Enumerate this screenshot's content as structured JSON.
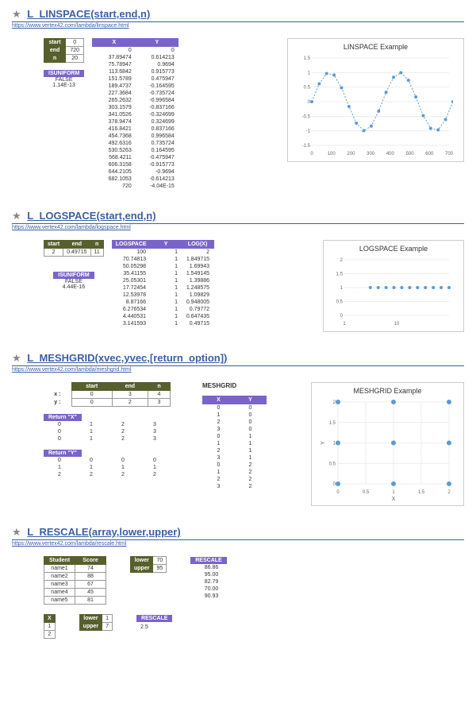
{
  "linspace": {
    "bullet": "★",
    "title": "L_LINSPACE(start,end,n)",
    "url": "https://www.vertex42.com/lambda/linspace.html",
    "params": {
      "labels": {
        "start": "start",
        "end": "end",
        "n": "n"
      },
      "values": {
        "start": "0",
        "end": "720",
        "n": "20"
      }
    },
    "isuniform": {
      "label": "ISUNIFORM",
      "val1": "FALSE",
      "val2": "1.14E-13"
    },
    "xy_header": {
      "x": "X",
      "y": "Y"
    },
    "xy": [
      [
        "0",
        "0"
      ],
      [
        "37.89474",
        "0.614213"
      ],
      [
        "75.78947",
        "0.9694"
      ],
      [
        "113.6842",
        "0.915773"
      ],
      [
        "151.5789",
        "0.475947"
      ],
      [
        "189.4737",
        "-0.164595"
      ],
      [
        "227.3684",
        "-0.735724"
      ],
      [
        "265.2632",
        "-0.996584"
      ],
      [
        "303.1579",
        "-0.837166"
      ],
      [
        "341.0526",
        "-0.324699"
      ],
      [
        "378.9474",
        "0.324699"
      ],
      [
        "416.8421",
        "0.837166"
      ],
      [
        "454.7368",
        "0.996584"
      ],
      [
        "492.6316",
        "0.735724"
      ],
      [
        "530.5263",
        "0.164595"
      ],
      [
        "568.4211",
        "-0.475947"
      ],
      [
        "606.3158",
        "-0.915773"
      ],
      [
        "644.2105",
        "-0.9694"
      ],
      [
        "682.1053",
        "-0.614213"
      ],
      [
        "720",
        "-4.04E-15"
      ]
    ],
    "chart": {
      "title": "LINSPACE Example",
      "x_ticks": [
        "0",
        "100",
        "200",
        "300",
        "400",
        "500",
        "600",
        "700"
      ],
      "y_ticks": [
        "-1.5",
        "-1",
        "-0.5",
        "0",
        "0.5",
        "1",
        "1.5"
      ]
    }
  },
  "logspace": {
    "bullet": "★",
    "title": "L_LOGSPACE(start,end,n)",
    "url": "https://www.vertex42.com/lambda/logspace.html",
    "params": {
      "labels": {
        "start": "start",
        "end": "end",
        "n": "n"
      },
      "values": {
        "start": "2",
        "end": "0.49715",
        "n": "11"
      }
    },
    "isuniform": {
      "label": "ISUNIFORM",
      "val1": "FALSE",
      "val2": "4.44E-16"
    },
    "header": {
      "a": "LOGSPACE",
      "b": "Y",
      "c": "LOG(X)"
    },
    "rows": [
      [
        "100",
        "1",
        "2"
      ],
      [
        "70.74813",
        "1",
        "1.849715"
      ],
      [
        "50.05298",
        "1",
        "1.69943"
      ],
      [
        "35.41155",
        "1",
        "1.549145"
      ],
      [
        "25.05301",
        "1",
        "1.39886"
      ],
      [
        "17.72454",
        "1",
        "1.248575"
      ],
      [
        "12.53978",
        "1",
        "1.09829"
      ],
      [
        "8.87166",
        "1",
        "0.948005"
      ],
      [
        "6.276534",
        "1",
        "0.79772"
      ],
      [
        "4.440531",
        "1",
        "0.647435"
      ],
      [
        "3.141593",
        "1",
        "0.49715"
      ]
    ],
    "chart": {
      "title": "LOGSPACE Example",
      "x_ticks": [
        "1",
        "10"
      ],
      "y_ticks": [
        "0",
        "0.5",
        "1",
        "1.5",
        "2"
      ]
    }
  },
  "meshgrid": {
    "bullet": "★",
    "title": "L_MESHGRID(xvec,yvec,[return_option])",
    "url": "https://www.vertex42.com/lambda/meshgrid.html",
    "header": {
      "start": "start",
      "end": "end",
      "n": "n"
    },
    "x_label": "x :",
    "y_label": "y :",
    "x_row": [
      "0",
      "3",
      "4"
    ],
    "y_row": [
      "0",
      "2",
      "3"
    ],
    "retX": {
      "label": "Return \"X\"",
      "rows": [
        [
          "0",
          "1",
          "2",
          "3"
        ],
        [
          "0",
          "1",
          "2",
          "3"
        ],
        [
          "0",
          "1",
          "2",
          "3"
        ]
      ]
    },
    "retY": {
      "label": "Return \"Y\"",
      "rows": [
        [
          "0",
          "0",
          "0",
          "0"
        ],
        [
          "1",
          "1",
          "1",
          "1"
        ],
        [
          "2",
          "2",
          "2",
          "2"
        ]
      ]
    },
    "mesh_header": "MESHGRID",
    "mesh_xy_header": {
      "x": "X",
      "y": "Y"
    },
    "mesh_rows": [
      [
        "0",
        "0"
      ],
      [
        "1",
        "0"
      ],
      [
        "2",
        "0"
      ],
      [
        "3",
        "0"
      ],
      [
        "0",
        "1"
      ],
      [
        "1",
        "1"
      ],
      [
        "2",
        "1"
      ],
      [
        "3",
        "1"
      ],
      [
        "0",
        "2"
      ],
      [
        "1",
        "2"
      ],
      [
        "2",
        "2"
      ],
      [
        "3",
        "2"
      ]
    ],
    "chart": {
      "title": "MESHGRID Example",
      "xlabel": "X",
      "ylabel": "Y",
      "x_ticks": [
        "0",
        "0.5",
        "1",
        "1.5",
        "2"
      ],
      "y_ticks": [
        "0",
        "0.5",
        "1",
        "1.5",
        "2"
      ]
    }
  },
  "rescale": {
    "bullet": "★",
    "title": "L_RESCALE(array,lower,upper)",
    "url": "https://www.vertex42.com/lambda/rescale.html",
    "table1": {
      "header": {
        "a": "Student",
        "b": "Score"
      },
      "rows": [
        [
          "name1",
          "74"
        ],
        [
          "name2",
          "88"
        ],
        [
          "name3",
          "67"
        ],
        [
          "name4",
          "45"
        ],
        [
          "name5",
          "81"
        ]
      ]
    },
    "bounds1": {
      "lower_label": "lower",
      "lower": "70",
      "upper_label": "upper",
      "upper": "95"
    },
    "rescale_label": "RESCALE",
    "out1": [
      "86.86",
      "95.00",
      "82.79",
      "70.00",
      "90.93"
    ],
    "table2": {
      "header": "X",
      "rows": [
        "1",
        "2"
      ]
    },
    "bounds2": {
      "lower_label": "lower",
      "lower": "1",
      "upper_label": "upper",
      "upper": "7"
    },
    "out2": [
      "",
      "2.5"
    ]
  },
  "chart_data": [
    {
      "type": "line",
      "title": "LINSPACE Example",
      "x": [
        0,
        37.89,
        75.79,
        113.68,
        151.58,
        189.47,
        227.37,
        265.26,
        303.16,
        341.05,
        378.95,
        416.84,
        454.74,
        492.63,
        530.53,
        568.42,
        606.32,
        644.21,
        682.11,
        720
      ],
      "series": [
        {
          "name": "Y",
          "values": [
            0,
            0.614,
            0.969,
            0.916,
            0.476,
            -0.165,
            -0.736,
            -0.997,
            -0.837,
            -0.325,
            0.325,
            0.837,
            0.997,
            0.736,
            0.165,
            -0.476,
            -0.916,
            -0.969,
            -0.614,
            0
          ]
        }
      ],
      "xlim": [
        0,
        700
      ],
      "ylim": [
        -1.5,
        1.5
      ],
      "xlabel": "",
      "ylabel": ""
    },
    {
      "type": "scatter",
      "title": "LOGSPACE Example",
      "x": [
        100,
        70.75,
        50.05,
        35.41,
        25.05,
        17.72,
        12.54,
        8.87,
        6.28,
        4.44,
        3.14
      ],
      "series": [
        {
          "name": "Y",
          "values": [
            1,
            1,
            1,
            1,
            1,
            1,
            1,
            1,
            1,
            1,
            1
          ]
        }
      ],
      "xlim": [
        1,
        100
      ],
      "ylim": [
        0,
        2
      ],
      "xscale": "log",
      "xlabel": "",
      "ylabel": ""
    },
    {
      "type": "scatter",
      "title": "MESHGRID Example",
      "x": [
        0,
        1,
        2,
        0,
        1,
        2,
        0,
        1,
        2
      ],
      "series": [
        {
          "name": "Y",
          "values": [
            0,
            0,
            0,
            1,
            1,
            1,
            2,
            2,
            2
          ]
        }
      ],
      "xlim": [
        0,
        2
      ],
      "ylim": [
        0,
        2
      ],
      "xlabel": "X",
      "ylabel": "Y"
    }
  ]
}
